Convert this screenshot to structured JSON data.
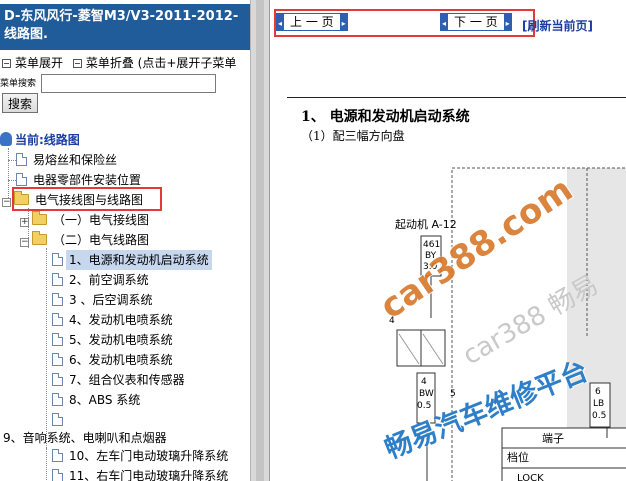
{
  "sidebar": {
    "doc_title": "D-东风风行-菱智M3/V3-2011-2012- 线路图.",
    "menu_expand": "菜单展开",
    "menu_collapse": "菜单折叠 (点击+展开子菜单",
    "search_label": "菜单搜索",
    "search_placeholder": "",
    "search_button": "搜索",
    "current_label": "当前:线路图",
    "items": [
      {
        "label": "易熔丝和保险丝"
      },
      {
        "label": "电器零部件安装位置"
      },
      {
        "label": "电气接线图与线路图"
      },
      {
        "label": "（一）电气接线图"
      },
      {
        "label": "（二）电气线路图"
      },
      {
        "label": "1、电源和发动机启动系统"
      },
      {
        "label": "2、前空调系统"
      },
      {
        "label": "3 、后空调系统"
      },
      {
        "label": "4、发动机电喷系统"
      },
      {
        "label": "5、发动机电喷系统"
      },
      {
        "label": "6、发动机电喷系统"
      },
      {
        "label": "7、组合仪表和传感器"
      },
      {
        "label": "8、ABS 系统"
      },
      {
        "label": ""
      },
      {
        "label": "9、音响系统、电喇叭和点烟器"
      },
      {
        "label": "10、左车门电动玻璃升降系统"
      },
      {
        "label": "11、右车门电动玻璃升降系统"
      }
    ]
  },
  "toolbar": {
    "prev_label": "上 一 页",
    "next_label": "下 一 页",
    "refresh_label": "[刷新当前页]"
  },
  "document": {
    "section_title": "1、 电源和发动机启动系统",
    "section_sub": "（1）配三幅方向盘",
    "diagram": {
      "starter_label": "起动机 A-12",
      "fuse_main": [
        "461",
        "BY",
        "3.0"
      ],
      "col_labels": [
        "4",
        "BW",
        "0.5",
        "5"
      ],
      "right_labels": [
        "6",
        "LB",
        "0.5"
      ],
      "terminal_label": "端子",
      "gear_label": "档位",
      "lock_label": "LOCK",
      "left_num": "4"
    },
    "watermarks": [
      "car388.com",
      "畅易汽车维修平台",
      "car388 畅易"
    ]
  }
}
